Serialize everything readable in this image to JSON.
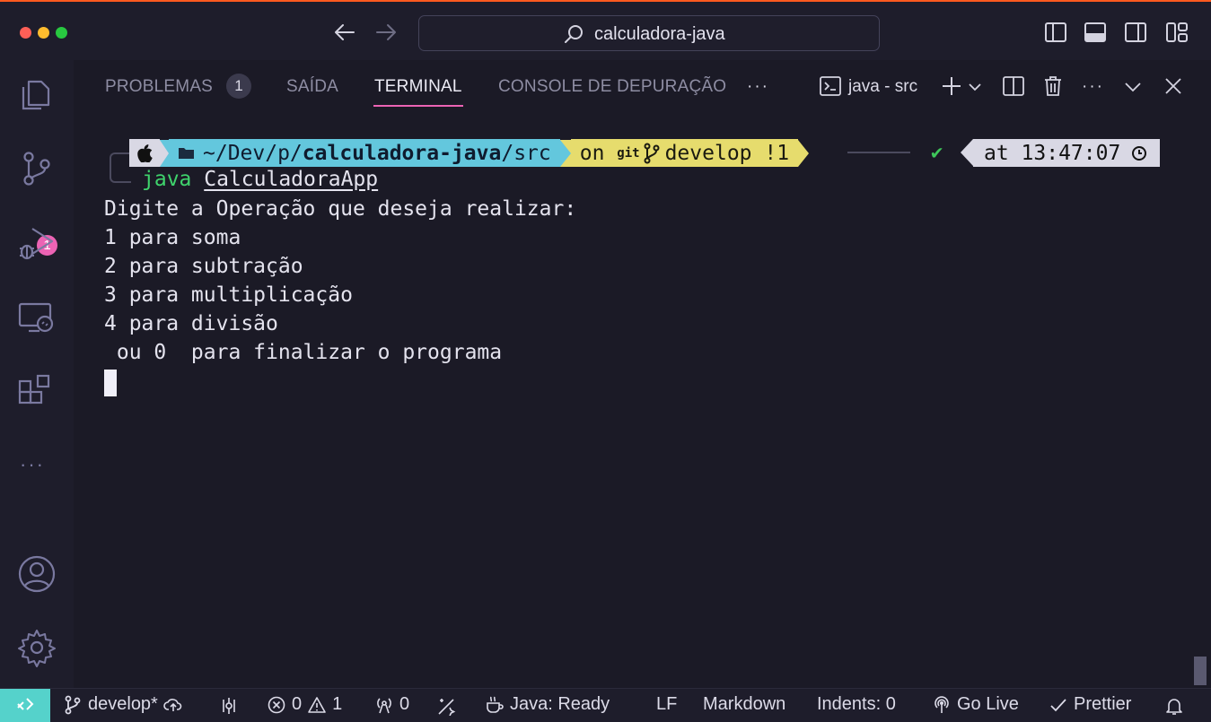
{
  "window": {
    "title": "calculadora-java"
  },
  "panel": {
    "tabs": [
      {
        "label": "PROBLEMAS",
        "count": "1"
      },
      {
        "label": "SAÍDA"
      },
      {
        "label": "TERMINAL"
      },
      {
        "label": "CONSOLE DE DEPURAÇÃO"
      }
    ],
    "more": "···",
    "terminal_name": "java - src"
  },
  "activity": {
    "source_control_badge": "1",
    "more": "···"
  },
  "prompt": {
    "path_prefix": "~/Dev/p/",
    "path_bold": "calculadora-java",
    "path_suffix": "/src",
    "git_on": "on ",
    "git_label": "git",
    "branch": "develop !1",
    "check": "✔",
    "time": "at 13:47:07"
  },
  "terminal": {
    "command": "java",
    "argument": "CalculadoraApp",
    "output_lines": [
      "Digite a Operação que deseja realizar:",
      "1 para soma",
      "2 para subtração",
      "3 para multiplicação",
      "4 para divisão",
      " ou 0  para finalizar o programa"
    ]
  },
  "statusbar": {
    "branch": "develop*",
    "errors": "0",
    "warnings": "1",
    "ports": "0",
    "java": "Java: Ready",
    "eol": "LF",
    "language": "Markdown",
    "indents": "Indents: 0",
    "golive": "Go Live",
    "prettier": "Prettier"
  },
  "colors": {
    "accent": "#ec63b4",
    "path_segment": "#63c7dd",
    "git_segment": "#e6dc6d",
    "remote": "#55d2cb"
  }
}
